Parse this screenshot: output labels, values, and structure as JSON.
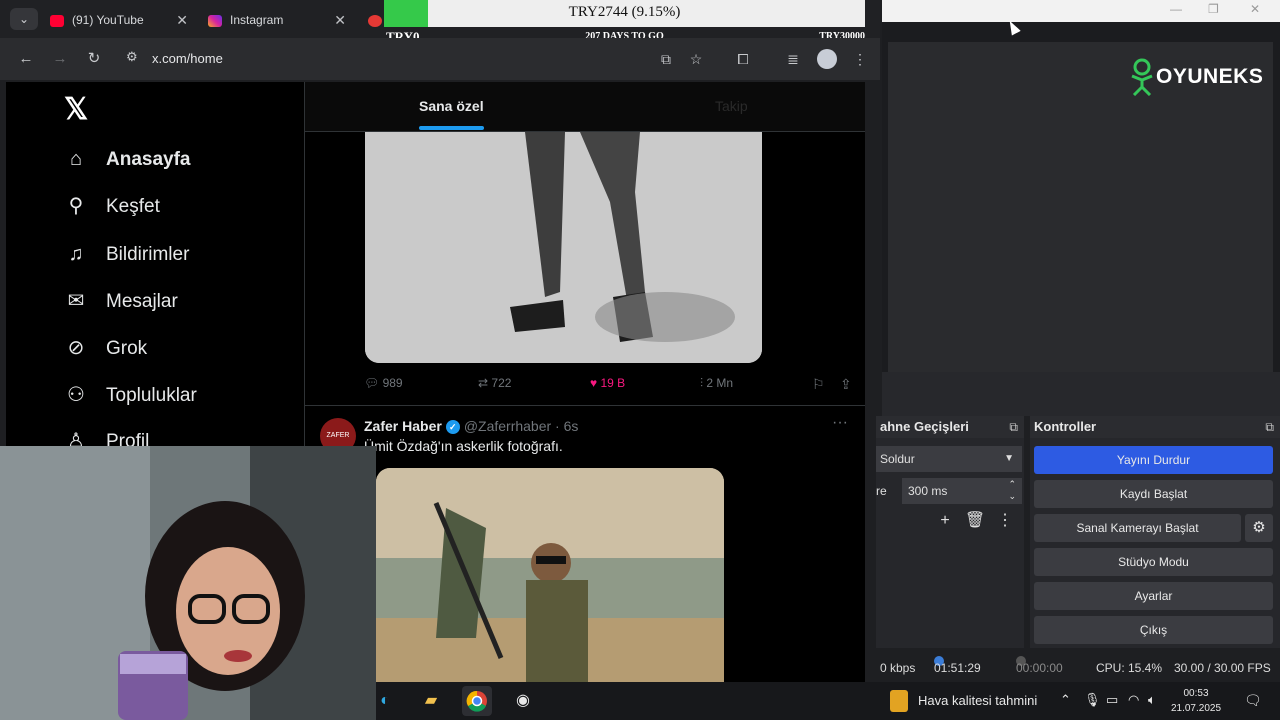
{
  "browser": {
    "tabs": [
      {
        "label": "(91) YouTube",
        "icon": "youtube-icon",
        "color": "#ff0033"
      },
      {
        "label": "Instagram",
        "icon": "instagram-icon",
        "color": "#d6249f"
      }
    ],
    "url": "x.com/home"
  },
  "crypto_widget": {
    "main": "TRY2744 (9.15%)",
    "left": "TRY0",
    "middle": "207 DAYS TO GO",
    "right": "TRY30000",
    "progress_percent": 9.15,
    "fill_color": "#35c94a"
  },
  "x": {
    "nav": [
      {
        "label": "Anasayfa",
        "icon": "home-icon",
        "glyph": "⌂"
      },
      {
        "label": "Keşfet",
        "icon": "search-icon",
        "glyph": "⚲"
      },
      {
        "label": "Bildirimler",
        "icon": "bell-icon",
        "glyph": "♫"
      },
      {
        "label": "Mesajlar",
        "icon": "mail-icon",
        "glyph": "✉"
      },
      {
        "label": "Grok",
        "icon": "grok-icon",
        "glyph": "⊘"
      },
      {
        "label": "Topluluklar",
        "icon": "communities-icon",
        "glyph": "⚇"
      },
      {
        "label": "Profil",
        "icon": "profile-icon",
        "glyph": "♙"
      }
    ],
    "feed_tabs": [
      "Sana özel",
      "Takip"
    ],
    "post_actions": {
      "replies": "989",
      "reposts": "722",
      "likes": "19 B",
      "views": "2 Mn"
    },
    "tweet": {
      "name": "Zafer Haber",
      "handle": "@Zaferrhaber · 6s",
      "avatar_text": "ZAFER",
      "text": "Ümit Özdağ'ın askerlik fotoğrafı."
    },
    "accent_color": "#1d9bf0"
  },
  "obs": {
    "logo": "OYUNEKS",
    "transitions": {
      "title": "ahne Geçişleri",
      "type": "Soldur",
      "duration_label": "re",
      "duration": "300 ms"
    },
    "controls": {
      "title": "Kontroller",
      "buttons": [
        "Yayını Durdur",
        "Kaydı Başlat",
        "Sanal Kamerayı Başlat",
        "Stüdyo Modu",
        "Ayarlar",
        "Çıkış"
      ]
    },
    "status": {
      "bitrate": "0 kbps",
      "stream_time": "01:51:29",
      "record_time": "00:00:00",
      "cpu": "CPU: 15.4%",
      "fps": "30.00 / 30.00 FPS"
    },
    "primary_color": "#2d5be3"
  },
  "taskbar": {
    "weather": "Hava kalitesi tahmini",
    "time": "00:53",
    "date": "21.07.2025"
  }
}
